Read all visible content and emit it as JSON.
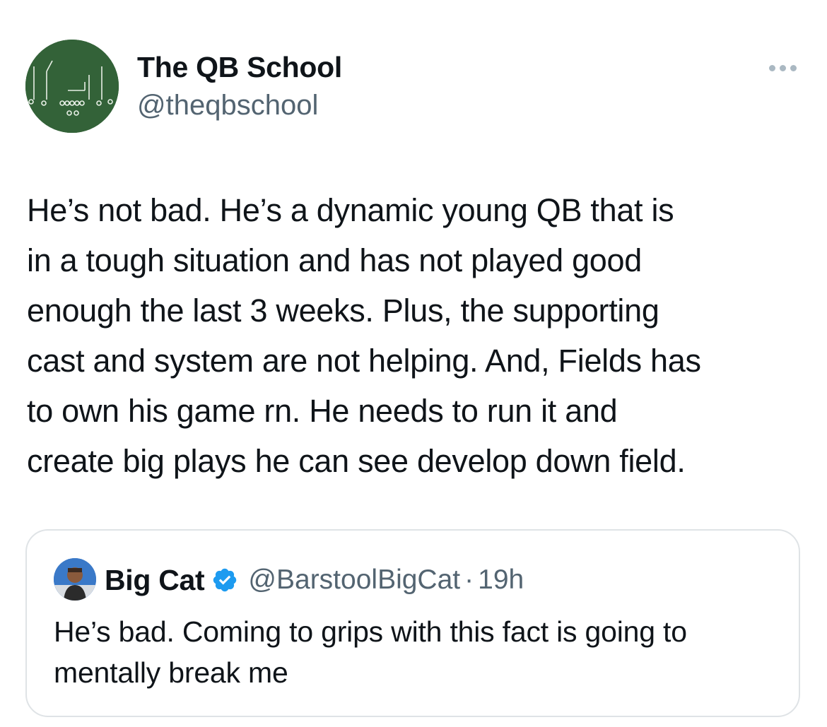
{
  "author": {
    "display_name": "The QB School",
    "handle": "@theqbschool",
    "avatar_icon": "play-diagram-avatar-icon"
  },
  "more_icon": "more-dots-icon",
  "tweet": {
    "text": "He’s not bad. He’s a dynamic young QB that is\nin a tough situation and has not played good\nenough the last 3 weeks. Plus, the supporting\ncast and system are not helping. And, Fields has\nto own his game rn. He needs to run it and\ncreate big plays he can see develop down field."
  },
  "quoted_tweet": {
    "display_name": "Big Cat",
    "verified_icon": "verified-badge-icon",
    "handle": "@BarstoolBigCat",
    "separator": "·",
    "time": "19h",
    "text": "He’s bad. Coming to grips with this fact is going to\nmentally break me"
  },
  "colors": {
    "text_primary": "#0f1419",
    "text_secondary": "#536471",
    "verified_blue": "#1d9bf0",
    "card_border": "#dfe3e6",
    "avatar_green": "#2f5d35"
  }
}
